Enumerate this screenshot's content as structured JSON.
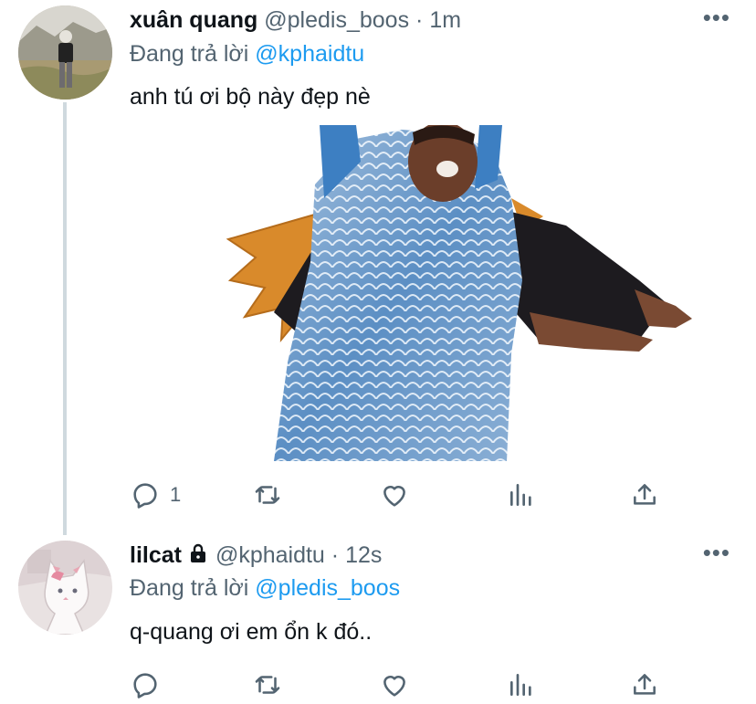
{
  "tweets": [
    {
      "name": "xuân quang",
      "handle": "@pledis_boos",
      "separator": "·",
      "time": "1m",
      "replying_prefix": "Đang trả lời",
      "replying_to": "@kphaidtu",
      "text": "anh tú ơi bộ này đẹp nè",
      "reply_count": "1",
      "has_media": true
    },
    {
      "name": "lilcat",
      "protected": true,
      "handle": "@kphaidtu",
      "separator": "·",
      "time": "12s",
      "replying_prefix": "Đang trả lời",
      "replying_to": "@pledis_boos",
      "text": "q-quang ơi em ổn k đó..",
      "reply_count": ""
    }
  ],
  "more_glyph": "•••",
  "colors": {
    "text_primary": "#0f1419",
    "text_secondary": "#536471",
    "link": "#1d9bf0",
    "thread_line": "#cfd9de"
  },
  "icons": {
    "reply": "reply-icon",
    "retweet": "retweet-icon",
    "like": "heart-icon",
    "views": "views-chart-icon",
    "share": "share-icon",
    "lock": "lock-icon",
    "more": "more-options-icon"
  }
}
